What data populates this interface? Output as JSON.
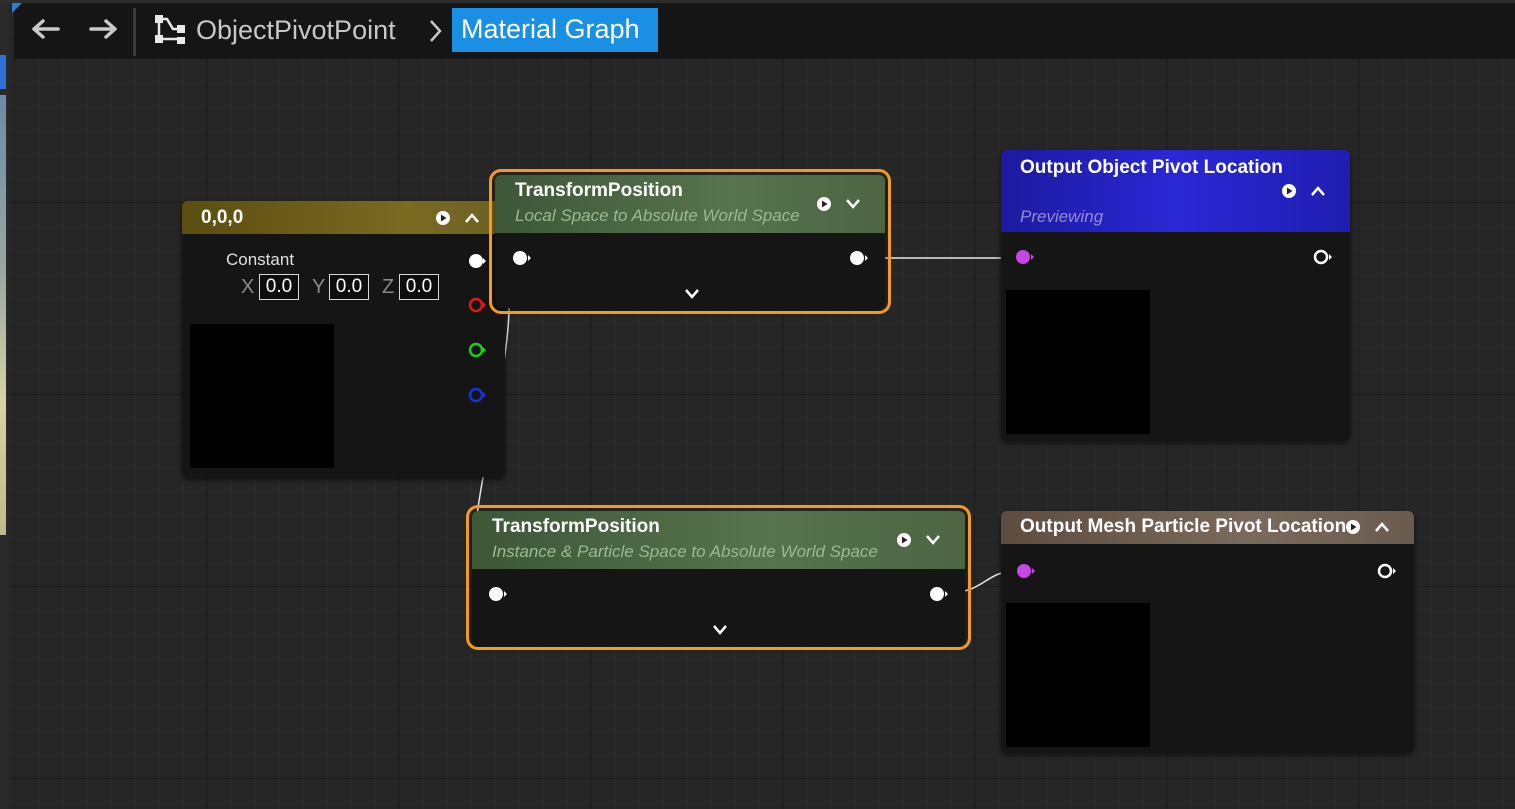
{
  "breadcrumb": {
    "root": "ObjectPivotPoint",
    "active": "Material Graph"
  },
  "icons": {
    "back": "arrow-left-icon",
    "forward": "arrow-right-icon",
    "graph": "graph-tree-icon"
  },
  "nodes": {
    "constant": {
      "title": "0,0,0",
      "label": "Constant",
      "x_label": "X",
      "x_value": "0.0",
      "y_label": "Y",
      "y_value": "0.0",
      "z_label": "Z",
      "z_value": "0.0"
    },
    "transform1": {
      "title": "TransformPosition",
      "subtitle": "Local Space to Absolute World Space"
    },
    "transform2": {
      "title": "TransformPosition",
      "subtitle": "Instance & Particle Space to Absolute World Space"
    },
    "output1": {
      "title": "Output Object Pivot Location",
      "subtitle": "Previewing"
    },
    "output2": {
      "title": "Output Mesh Particle Pivot Location"
    }
  },
  "colors": {
    "accent_blue": "#1a8fe3",
    "selection": "#f39b1f",
    "constant_header": "#6e5d16",
    "transform_header": "#4d6a45",
    "output_header_blue": "#1a17b8",
    "output_header_brown": "#6e5e50",
    "pin_purple": "#c845e6"
  }
}
